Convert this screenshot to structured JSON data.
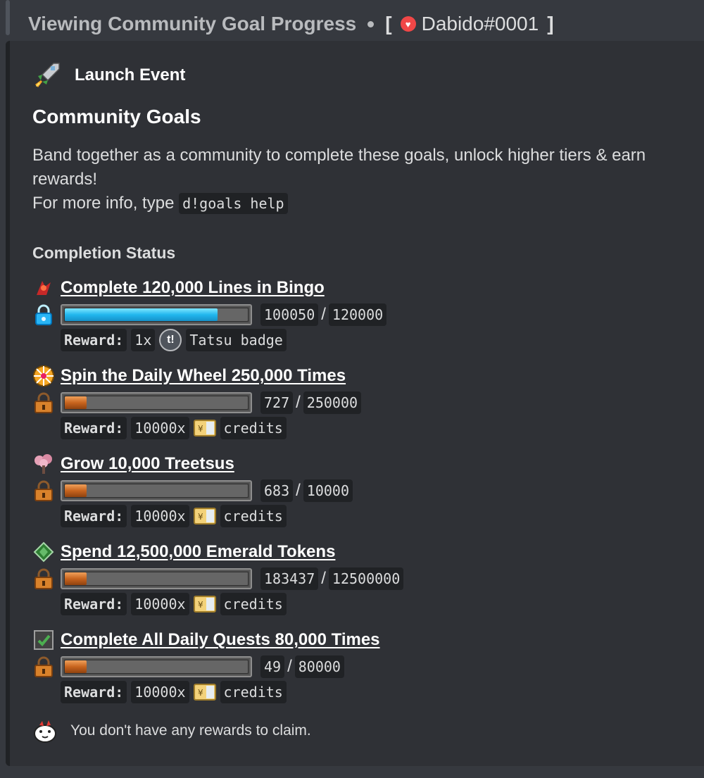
{
  "header": {
    "title": "Viewing Community Goal Progress",
    "bracket_open": "[",
    "user": "Dabido#0001",
    "bracket_close": "]"
  },
  "embed": {
    "author": "Launch Event",
    "title": "Community Goals",
    "description_line1": "Band together as a community to complete these goals, unlock higher tiers & earn rewards!",
    "description_line2_prefix": "For more info, type",
    "help_command": "d!goals help",
    "field_name": "Completion Status",
    "footer_text": "You don't have any rewards to claim."
  },
  "goals": [
    {
      "title": "Complete 120,000 Lines in Bingo",
      "icon": "bingo-icon",
      "status_icon": "unlocked-icon",
      "progress": 0.834,
      "current": "100050",
      "target": "120000",
      "reward_label": "Reward:",
      "reward_qty": "1x",
      "reward_name": "Tatsu badge",
      "reward_icon": "tatsu-badge-icon"
    },
    {
      "title": "Spin the Daily Wheel 250,000 Times",
      "icon": "wheel-icon",
      "status_icon": "lock-icon",
      "progress": 0.003,
      "current": "727",
      "target": "250000",
      "reward_label": "Reward:",
      "reward_qty": "10000x",
      "reward_name": "credits",
      "reward_icon": "credits-icon"
    },
    {
      "title": "Grow 10,000 Treetsus",
      "icon": "tree-icon",
      "status_icon": "lock-icon",
      "progress": 0.068,
      "current": "683",
      "target": "10000",
      "reward_label": "Reward:",
      "reward_qty": "10000x",
      "reward_name": "credits",
      "reward_icon": "credits-icon"
    },
    {
      "title": "Spend 12,500,000 Emerald Tokens",
      "icon": "emerald-icon",
      "status_icon": "lock-icon",
      "progress": 0.015,
      "current": "183437",
      "target": "12500000",
      "reward_label": "Reward:",
      "reward_qty": "10000x",
      "reward_name": "credits",
      "reward_icon": "credits-icon"
    },
    {
      "title": "Complete All Daily Quests 80,000 Times",
      "icon": "quest-checklist-icon",
      "status_icon": "lock-icon",
      "progress": 0.001,
      "current": "49",
      "target": "80000",
      "reward_label": "Reward:",
      "reward_qty": "10000x",
      "reward_name": "credits",
      "reward_icon": "credits-icon"
    }
  ],
  "colors": {
    "background": "#36393f",
    "embed_bg": "#2f3136",
    "code_bg": "#202225",
    "progress_blue": "#21b7ee",
    "progress_orange": "#c8641e",
    "heart": "#f04747"
  }
}
